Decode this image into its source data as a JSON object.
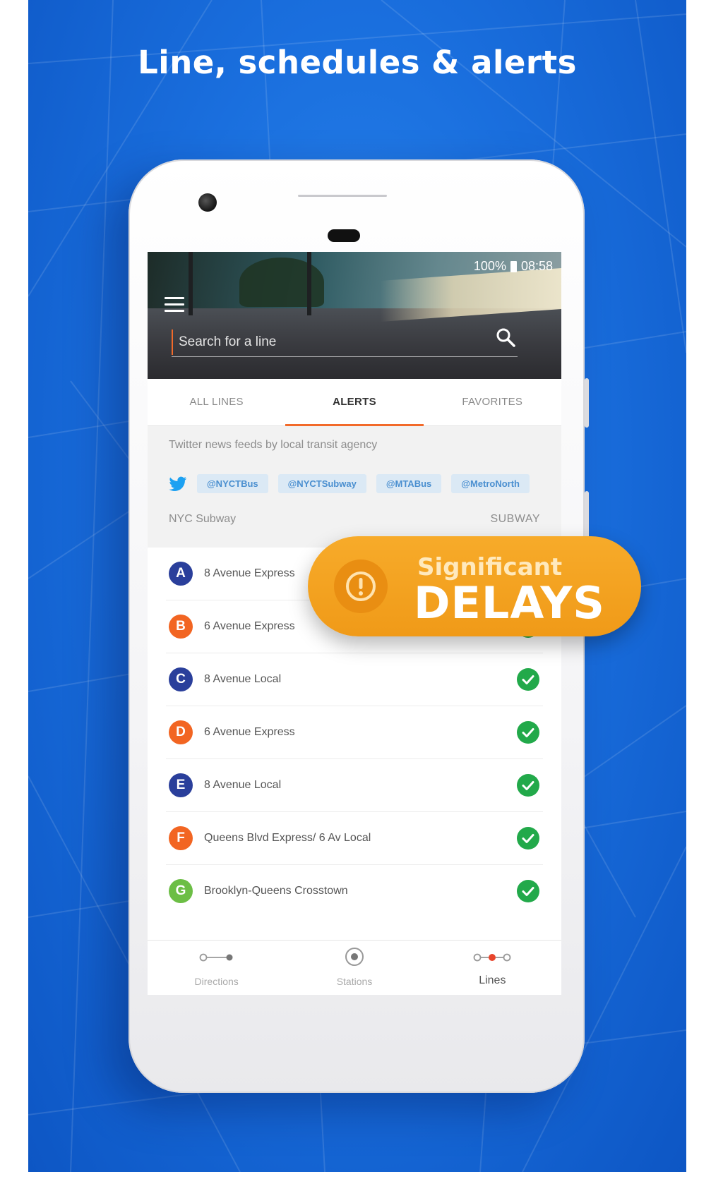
{
  "headline": "Line, schedules & alerts",
  "status_bar": {
    "battery": "100%",
    "time": "08:58"
  },
  "search": {
    "placeholder": "Search for a line"
  },
  "tabs": [
    {
      "label": "ALL LINES",
      "active": false
    },
    {
      "label": "ALERTS",
      "active": true
    },
    {
      "label": "FAVORITES",
      "active": false
    }
  ],
  "twitter": {
    "caption": "Twitter news feeds by local transit agency",
    "handles": [
      "@NYCTBus",
      "@NYCTSubway",
      "@MTABus",
      "@MetroNorth"
    ]
  },
  "section": {
    "title": "NYC Subway",
    "type": "SUBWAY"
  },
  "lines": [
    {
      "letter": "A",
      "name": "8 Avenue Express",
      "color": "#2a3f9b"
    },
    {
      "letter": "B",
      "name": "6 Avenue Express",
      "color": "#f26522"
    },
    {
      "letter": "C",
      "name": "8 Avenue Local",
      "color": "#2a3f9b"
    },
    {
      "letter": "D",
      "name": "6 Avenue Express",
      "color": "#f26522"
    },
    {
      "letter": "E",
      "name": "8 Avenue Local",
      "color": "#2a3f9b"
    },
    {
      "letter": "F",
      "name": "Queens Blvd Express/ 6 Av Local",
      "color": "#f26522"
    },
    {
      "letter": "G",
      "name": "Brooklyn-Queens Crosstown",
      "color": "#6cbe45"
    }
  ],
  "status_ok_color": "#22a94a",
  "bottom_nav": [
    {
      "label": "Directions",
      "icon": "directions-icon",
      "active": false
    },
    {
      "label": "Stations",
      "icon": "stations-icon",
      "active": false
    },
    {
      "label": "Lines",
      "icon": "lines-icon",
      "active": true
    }
  ],
  "alert": {
    "small": "Significant",
    "big": "DELAYS",
    "color": "#f5a623"
  },
  "colors": {
    "accent": "#f26a2a",
    "background": "#1a6fde"
  }
}
